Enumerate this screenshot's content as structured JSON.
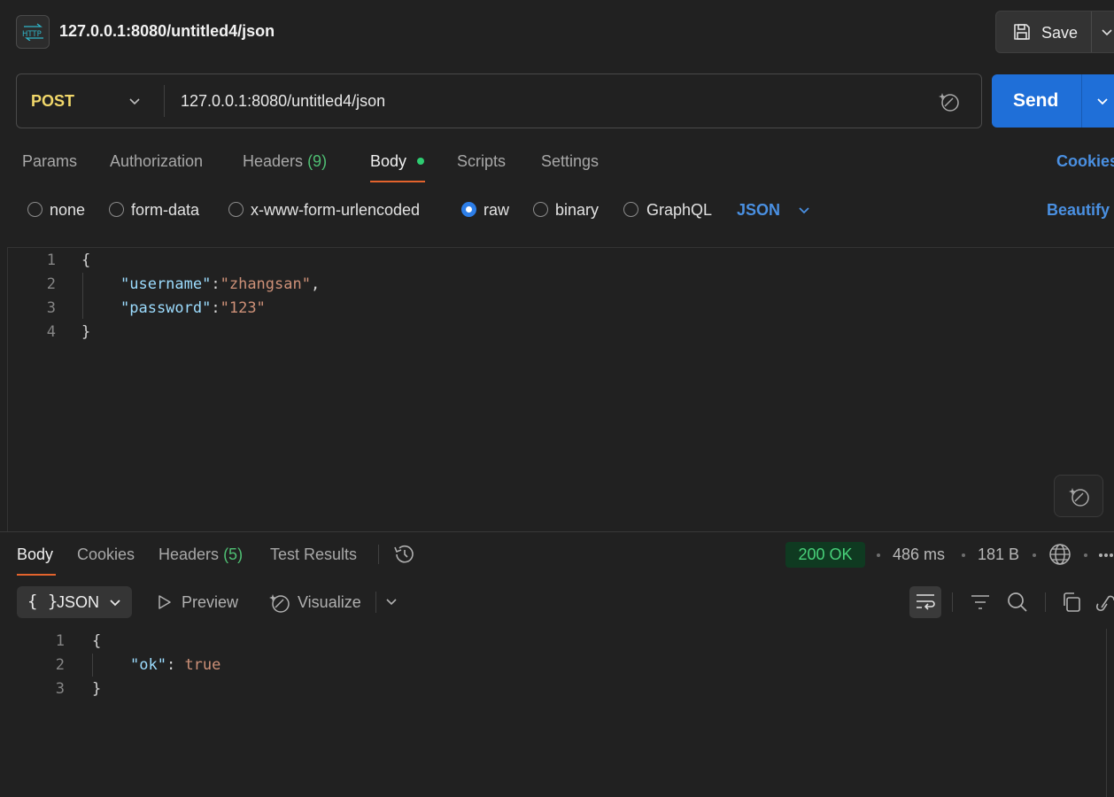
{
  "header": {
    "icon": "http-icon",
    "title": "127.0.0.1:8080/untitled4/json",
    "save_label": "Save"
  },
  "request": {
    "method": "POST",
    "url": "127.0.0.1:8080/untitled4/json",
    "send_label": "Send"
  },
  "request_tabs": {
    "params": "Params",
    "authorization": "Authorization",
    "headers": "Headers",
    "headers_count": "(9)",
    "body": "Body",
    "scripts": "Scripts",
    "settings": "Settings",
    "active": "Body",
    "cookies": "Cookies"
  },
  "body_types": {
    "none": "none",
    "form_data": "form-data",
    "urlencoded": "x-www-form-urlencoded",
    "raw": "raw",
    "binary": "binary",
    "graphql": "GraphQL",
    "selected": "raw",
    "language": "JSON",
    "beautify": "Beautify"
  },
  "request_body": {
    "line_numbers": [
      "1",
      "2",
      "3",
      "4"
    ],
    "open": "{",
    "close": "}",
    "fields": [
      {
        "key": "\"username\"",
        "colon": ":",
        "value": "\"zhangsan\"",
        "trail": ","
      },
      {
        "key": "\"password\"",
        "colon": ":",
        "value": "\"123\"",
        "trail": ""
      }
    ]
  },
  "response_tabs": {
    "body": "Body",
    "cookies": "Cookies",
    "headers": "Headers",
    "headers_count": "(5)",
    "test_results": "Test Results",
    "active": "Body"
  },
  "response_meta": {
    "status": "200 OK",
    "time": "486 ms",
    "size": "181 B"
  },
  "response_toolbar": {
    "format_braces": "{ }",
    "format": "JSON",
    "preview": "Preview",
    "visualize": "Visualize"
  },
  "response_body": {
    "line_numbers": [
      "1",
      "2",
      "3"
    ],
    "open": "{",
    "close": "}",
    "key": "\"ok\"",
    "colon": ": ",
    "value": "true"
  },
  "colors": {
    "accent_blue": "#1f6fd8",
    "tab_underline": "#e3632d",
    "method": "#f1d76a",
    "status_ok": "#48d17a"
  }
}
